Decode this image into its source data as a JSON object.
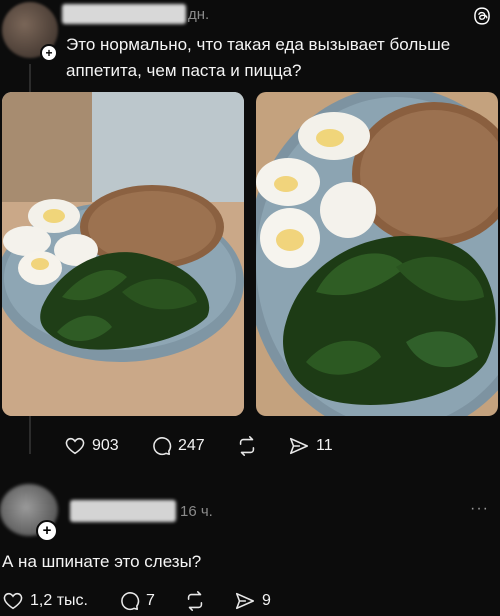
{
  "post": {
    "time_suffix": "дн.",
    "text": "Это нормально, что такая еда вызывает больше аппетита, чем паста и пицца?",
    "likes": "903",
    "comments": "247",
    "shares": "11",
    "icons": [
      "heart-icon",
      "comment-icon",
      "repost-icon",
      "share-icon",
      "threads-logo-icon"
    ]
  },
  "reply": {
    "time": "16 ч.",
    "more": "···",
    "text": "А на шпинате это слезы?",
    "likes": "1,2 тыс.",
    "comments": "7",
    "shares": "9"
  },
  "colors": {
    "background": "#0c0c0c",
    "text": "#f3f3f3",
    "muted": "#8a8a8a"
  }
}
